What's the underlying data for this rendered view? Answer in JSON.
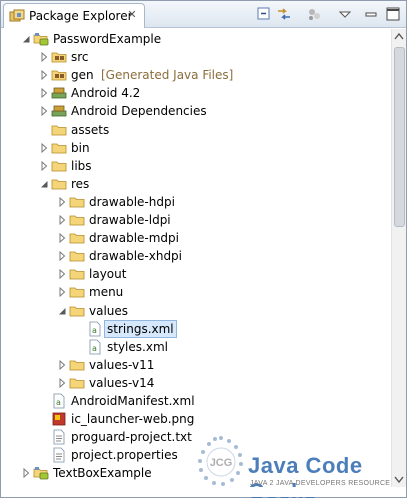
{
  "view": {
    "tab_label": "Package Explorer",
    "close_glyph": "✕"
  },
  "tree": [
    {
      "label": "PasswordExample",
      "icon": "android-project-icon",
      "state": "expanded"
    },
    {
      "label": "src",
      "icon": "source-folder-icon",
      "state": "collapsed"
    },
    {
      "label": "gen",
      "suffix": "[Generated Java Files]",
      "icon": "source-folder-icon",
      "state": "collapsed"
    },
    {
      "label": "Android 4.2",
      "icon": "library-icon",
      "state": "collapsed"
    },
    {
      "label": "Android Dependencies",
      "icon": "library-icon",
      "state": "collapsed"
    },
    {
      "label": "assets",
      "icon": "folder-icon",
      "state": "leaf"
    },
    {
      "label": "bin",
      "icon": "folder-icon",
      "state": "collapsed"
    },
    {
      "label": "libs",
      "icon": "folder-icon",
      "state": "collapsed"
    },
    {
      "label": "res",
      "icon": "folder-icon",
      "state": "expanded"
    },
    {
      "label": "drawable-hdpi",
      "icon": "folder-icon",
      "state": "collapsed"
    },
    {
      "label": "drawable-ldpi",
      "icon": "folder-icon",
      "state": "collapsed"
    },
    {
      "label": "drawable-mdpi",
      "icon": "folder-icon",
      "state": "collapsed"
    },
    {
      "label": "drawable-xhdpi",
      "icon": "folder-icon",
      "state": "collapsed"
    },
    {
      "label": "layout",
      "icon": "folder-icon",
      "state": "collapsed"
    },
    {
      "label": "menu",
      "icon": "folder-icon",
      "state": "collapsed"
    },
    {
      "label": "values",
      "icon": "folder-icon",
      "state": "expanded"
    },
    {
      "label": "strings.xml",
      "icon": "xml-file-icon",
      "state": "leaf",
      "selected": true
    },
    {
      "label": "styles.xml",
      "icon": "xml-file-icon",
      "state": "leaf"
    },
    {
      "label": "values-v11",
      "icon": "folder-icon",
      "state": "collapsed"
    },
    {
      "label": "values-v14",
      "icon": "folder-icon",
      "state": "collapsed"
    },
    {
      "label": "AndroidManifest.xml",
      "icon": "xml-file-icon",
      "state": "leaf"
    },
    {
      "label": "ic_launcher-web.png",
      "icon": "image-file-icon",
      "state": "leaf"
    },
    {
      "label": "proguard-project.txt",
      "icon": "text-file-icon",
      "state": "leaf"
    },
    {
      "label": "project.properties",
      "icon": "text-file-icon",
      "state": "leaf"
    },
    {
      "label": "TextBoxExample",
      "icon": "android-project-icon",
      "state": "collapsed"
    }
  ],
  "watermark": {
    "logo_text": "JCG",
    "title": "Java Code Geeks",
    "subtitle": "JAVA 2 JAVA DEVELOPERS RESOURCE CENTER"
  }
}
